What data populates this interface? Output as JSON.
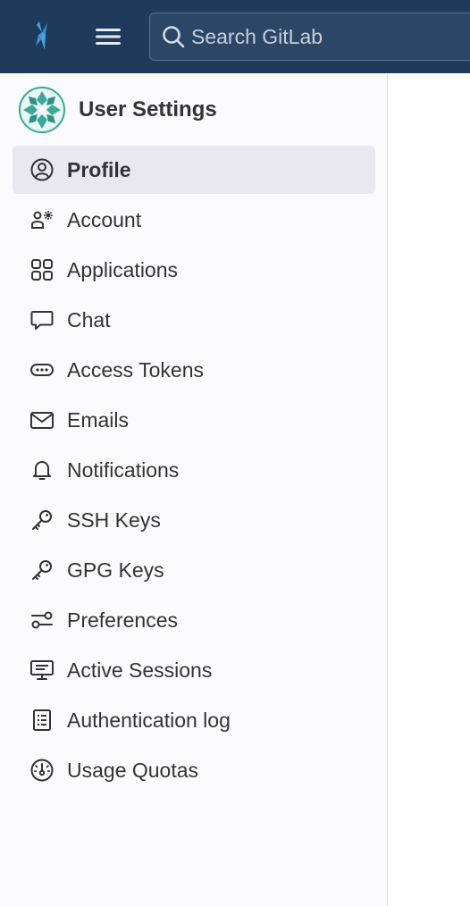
{
  "header": {
    "logo_icon": "gitlab-logo-icon",
    "menu_icon": "hamburger-menu-icon",
    "search": {
      "placeholder": "Search GitLab",
      "icon": "search-icon"
    }
  },
  "sidebar": {
    "context_title": "User Settings",
    "items": [
      {
        "label": "Profile",
        "icon": "profile-icon",
        "active": true
      },
      {
        "label": "Account",
        "icon": "account-icon"
      },
      {
        "label": "Applications",
        "icon": "applications-icon"
      },
      {
        "label": "Chat",
        "icon": "chat-icon"
      },
      {
        "label": "Access Tokens",
        "icon": "token-icon"
      },
      {
        "label": "Emails",
        "icon": "mail-icon"
      },
      {
        "label": "Notifications",
        "icon": "bell-icon"
      },
      {
        "label": "SSH Keys",
        "icon": "key-icon"
      },
      {
        "label": "GPG Keys",
        "icon": "key-icon"
      },
      {
        "label": "Preferences",
        "icon": "preferences-icon"
      },
      {
        "label": "Active Sessions",
        "icon": "monitor-icon"
      },
      {
        "label": "Authentication log",
        "icon": "log-icon"
      },
      {
        "label": "Usage Quotas",
        "icon": "gauge-icon"
      }
    ]
  },
  "colors": {
    "header_bg": "#1f3a5a",
    "sidebar_bg": "#fbfafd",
    "active_item_bg": "#e9e8ee",
    "text": "#333238"
  }
}
